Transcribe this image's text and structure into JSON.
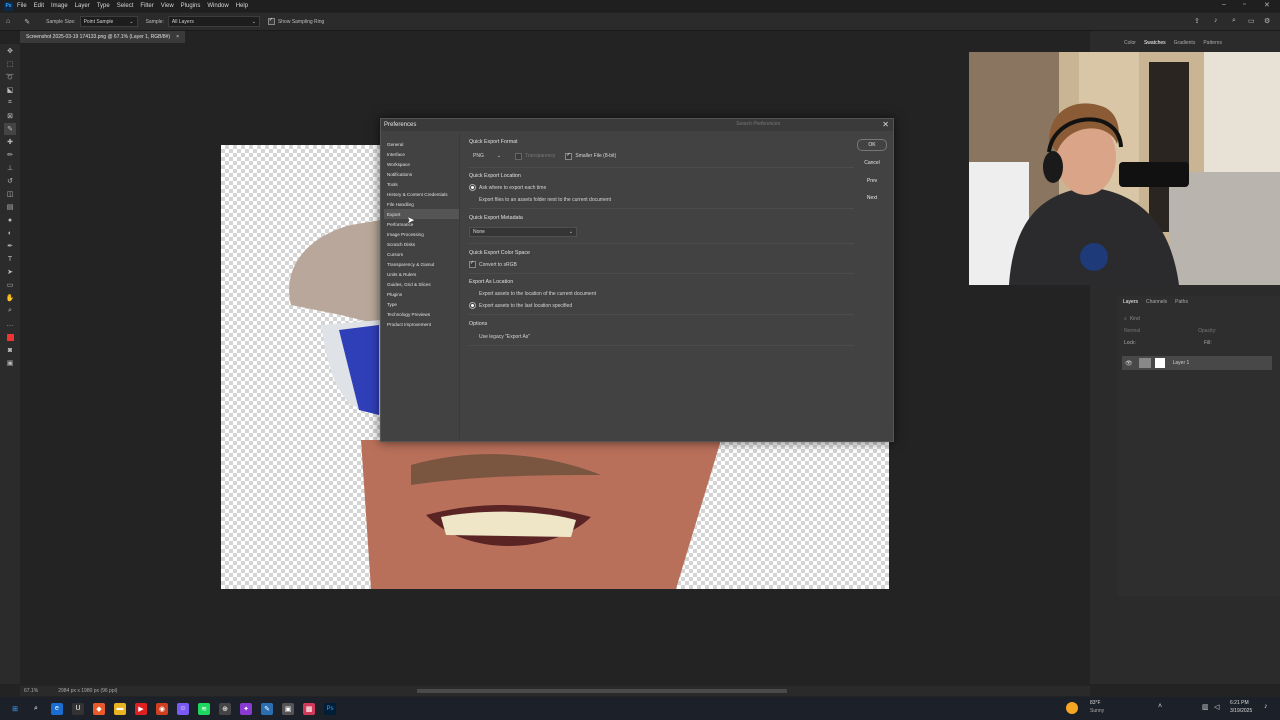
{
  "app": {
    "logo": "Ps",
    "menu": [
      "File",
      "Edit",
      "Image",
      "Layer",
      "Type",
      "Select",
      "Filter",
      "View",
      "Plugins",
      "Window",
      "Help"
    ]
  },
  "options_bar": {
    "sample_size_label": "Sample Size:",
    "sample_size_value": "Point Sample",
    "sample_label": "Sample:",
    "sample_value": "All Layers",
    "show_ring_label": "Show Sampling Ring"
  },
  "document": {
    "tab_title": "Screenshot 2025-03-19 174133.png @ 67.1% (Layer 1, RGB/8#)",
    "zoom": "67.1%",
    "size_info": "2984 px x 1980 px (96 ppi)"
  },
  "preferences": {
    "title": "Preferences",
    "search_placeholder": "Search Preferences",
    "nav": [
      "General",
      "Interface",
      "Workspace",
      "Notifications",
      "Tools",
      "History & Content Credentials",
      "File Handling",
      "Export",
      "Performance",
      "Image Processing",
      "Scratch Disks",
      "Cursors",
      "Transparency & Gamut",
      "Units & Rulers",
      "Guides, Grid & Slices",
      "Plugins",
      "Type",
      "Technology Previews",
      "Product Improvement"
    ],
    "active_nav": "Export",
    "quick_export_format": {
      "heading": "Quick Export Format",
      "format": "PNG",
      "transparency_label": "Transparency",
      "smaller_file_label": "Smaller File (8-bit)"
    },
    "quick_export_location": {
      "heading": "Quick Export Location",
      "opt1": "Ask where to export each time",
      "opt2": "Export files to an assets folder next to the current document"
    },
    "quick_export_metadata": {
      "heading": "Quick Export Metadata",
      "value": "None"
    },
    "quick_export_color_space": {
      "heading": "Quick Export Color Space",
      "convert_label": "Convert to sRGB"
    },
    "export_as_location": {
      "heading": "Export As Location",
      "opt1": "Export assets to the location of the current document",
      "opt2": "Export assets to the last location specified"
    },
    "options": {
      "heading": "Options",
      "legacy_label": "Use legacy \"Export As\""
    },
    "buttons": {
      "ok": "OK",
      "cancel": "Cancel",
      "prev": "Prev",
      "next": "Next"
    }
  },
  "right_panel": {
    "top_tabs": [
      "Color",
      "Swatches",
      "Gradients",
      "Patterns"
    ],
    "top_active": "Swatches",
    "layer_tabs": [
      "Layers",
      "Channels",
      "Paths"
    ],
    "layer_active": "Layers",
    "kind_placeholder": "Kind",
    "blend_mode": "Normal",
    "opacity_label": "Opacity:",
    "lock_label": "Lock:",
    "fill_label": "Fill:",
    "layer_name": "Layer 1"
  },
  "taskbar": {
    "weather_temp": "83°F",
    "weather_desc": "Sunny",
    "time": "6:21 PM",
    "date": "3/19/2025"
  }
}
